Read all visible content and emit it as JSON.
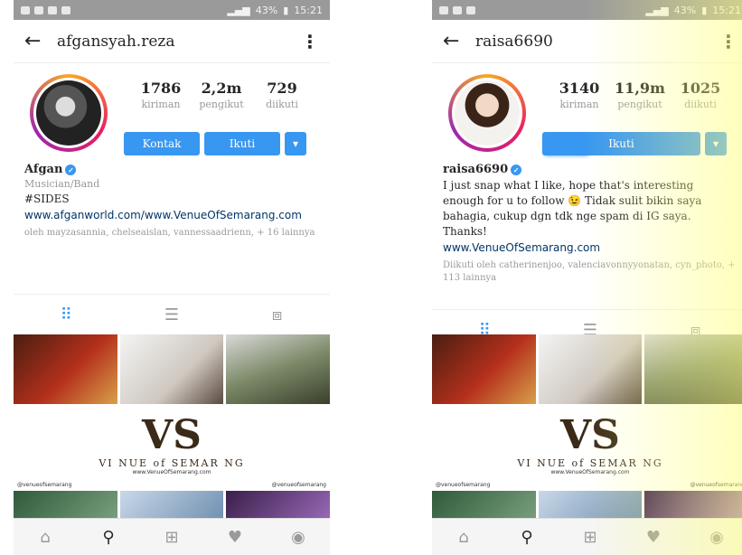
{
  "phones": [
    {
      "statusbar": {
        "battery": "43%",
        "time": "15:21"
      },
      "username": "afgansyah.reza",
      "stats": [
        {
          "value": "1786",
          "label": "kiriman"
        },
        {
          "value": "2,2m",
          "label": "pengikut"
        },
        {
          "value": "729",
          "label": "diikuti"
        }
      ],
      "buttons": {
        "contact": "Kontak",
        "follow": "Ikuti"
      },
      "bio": {
        "name": "Afgan",
        "category": "Musician/Band",
        "line1": "#SIDES",
        "website": "www.afganworld.com/www.VenueOfSemarang.com",
        "followed_by": "oleh mayzasannia, chelseaislan, vannessaadrienn, + 16 lainnya"
      }
    },
    {
      "statusbar": {
        "battery": "43%",
        "time": "15:21"
      },
      "username": "raisa6690",
      "stats": [
        {
          "value": "3140",
          "label": "kiriman"
        },
        {
          "value": "11,9m",
          "label": "pengikut"
        },
        {
          "value": "1025",
          "label": "diikuti"
        }
      ],
      "buttons": {
        "follow": "Ikuti"
      },
      "bio": {
        "name": "raisa6690",
        "text": "I just snap what I like, hope that's interesting enough for u to follow 😉 Tidak sulit bikin saya bahagia, cukup dgn tdk nge spam di IG saya. Thanks!",
        "website": "www.VenueOfSemarang.com",
        "followed_by": "Diikuti oleh catherinenjoo, valenciavonnyyonatan, cyn_photo, + 113 lainnya"
      }
    }
  ],
  "banner": {
    "logo": "VS",
    "tagline": "VI NUE of SEMAR NG",
    "url": "www.VenueOfSemarang.com",
    "ig_left": "@venueofsemarang",
    "ig_right": "@venueofsemarang"
  },
  "colors": {
    "accent": "#3897f0",
    "text": "#262626",
    "muted": "#999999",
    "link": "#003569"
  }
}
